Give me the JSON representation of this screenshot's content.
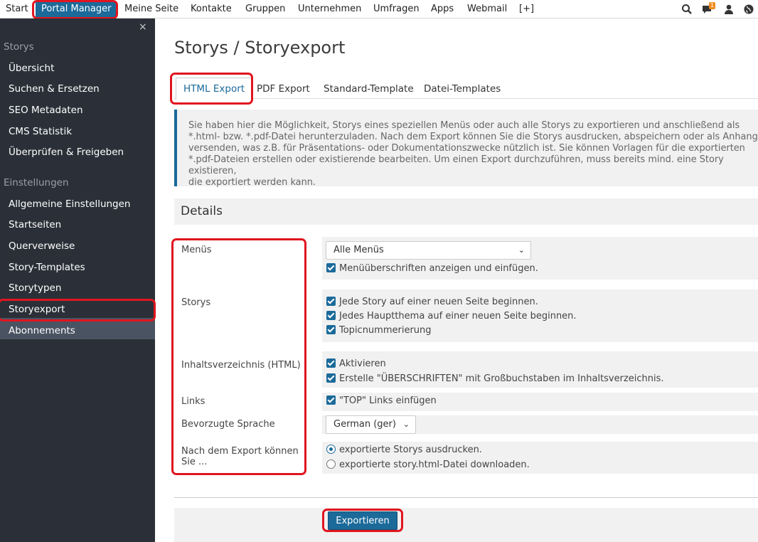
{
  "topnav": {
    "items": [
      "Start",
      "Portal Manager",
      "Meine Seite",
      "Kontakte",
      "Gruppen",
      "Unternehmen",
      "Umfragen",
      "Apps",
      "Webmail",
      "[+]"
    ],
    "notification_count": "1"
  },
  "sidebar": {
    "close": "×",
    "sections": [
      {
        "title": "Storys",
        "items": [
          "Übersicht",
          "Suchen & Ersetzen",
          "SEO Metadaten",
          "CMS Statistik",
          "Überprüfen & Freigeben"
        ]
      },
      {
        "title": "Einstellungen",
        "items": [
          "Allgemeine Einstellungen",
          "Startseiten",
          "Querverweise",
          "Story-Templates",
          "Storytypen",
          "Storyexport",
          "Abonnements"
        ]
      }
    ]
  },
  "page": {
    "title": "Storys / Storyexport",
    "tabs": [
      "HTML Export",
      "PDF Export",
      "Standard-Template",
      "Datei-Templates"
    ],
    "info_lines": [
      "Sie haben hier die Möglichkeit, Storys eines speziellen Menüs oder auch alle Storys zu exportieren und anschließend als",
      "*.html- bzw. *.pdf-Datei herunterzuladen. Nach dem Export können Sie die Storys ausdrucken, abspeichern oder als Anhang",
      "versenden, was z.B. für Präsentations- oder Dokumentationszwecke nützlich ist. Sie können Vorlagen für die exportierten",
      "*.pdf-Dateien erstellen oder existierende bearbeiten. Um einen Export durchzuführen, muss bereits mind. eine Story existieren,",
      "die exportiert werden kann."
    ],
    "details_title": "Details"
  },
  "form": {
    "menus_label": "Menüs",
    "menus_select": "Alle Menüs",
    "menus_check": "Menüüberschriften anzeigen und einfügen.",
    "storys_label": "Storys",
    "storys_checks": [
      "Jede Story auf einer neuen Seite beginnen.",
      "Jedes Hauptthema auf einer neuen Seite beginnen.",
      "Topicnummerierung"
    ],
    "toc_label": "Inhaltsverzeichnis (HTML)",
    "toc_checks": [
      "Aktivieren",
      "Erstelle \"ÜBERSCHRIFTEN\" mit Großbuchstaben im Inhaltsverzeichnis."
    ],
    "links_label": "Links",
    "links_check": "\"TOP\" Links einfügen",
    "lang_label": "Bevorzugte Sprache",
    "lang_select": "German (ger)",
    "after_label_1": "Nach dem Export können",
    "after_label_2": "Sie ...",
    "after_options": [
      "exportierte Storys ausdrucken.",
      "exportierte story.html-Datei downloaden."
    ],
    "export_button": "Exportieren"
  },
  "colors": {
    "accent": "#1b6a9a",
    "sidebar": "#2b3038",
    "highlight": "#e0151f"
  }
}
